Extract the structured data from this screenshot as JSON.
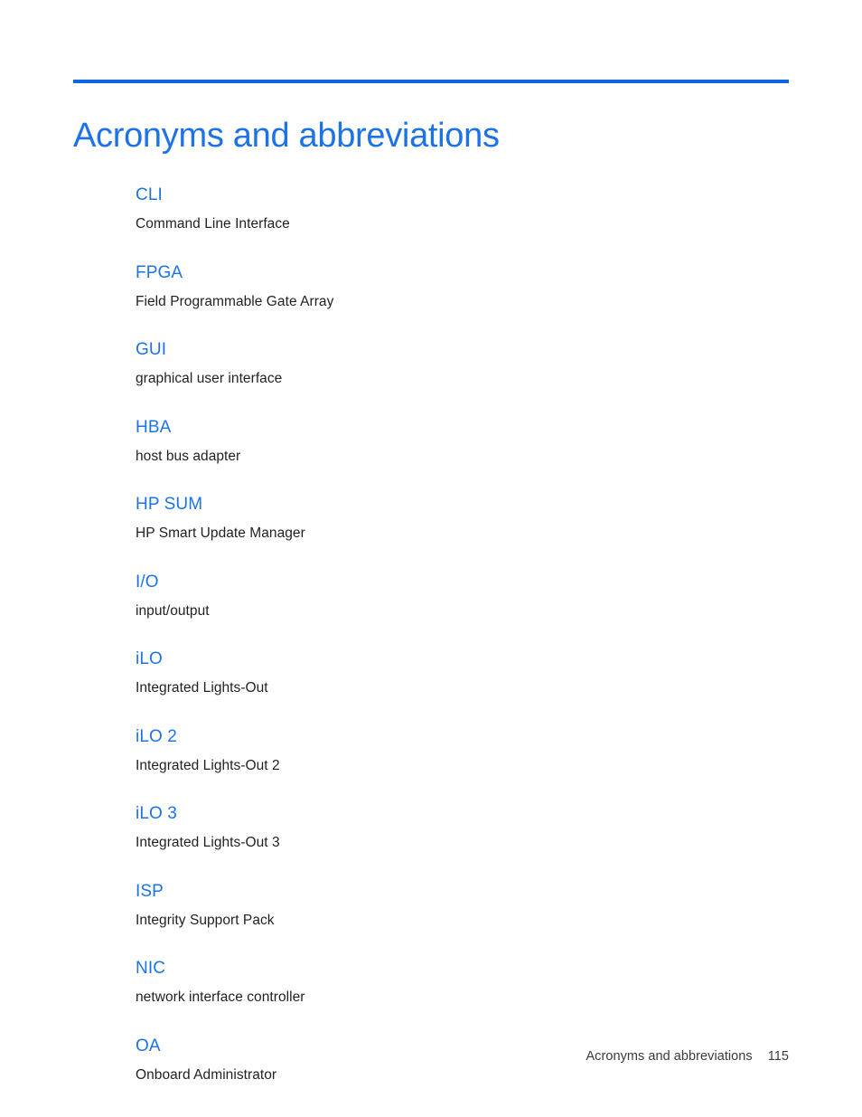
{
  "document": {
    "heading": "Acronyms and abbreviations",
    "accent_rule_color": "#0B66E4",
    "heading_color": "#1C73E8",
    "body_text_color": "#231F20"
  },
  "glossary": {
    "entries": [
      {
        "term": "CLI",
        "definition": "Command Line Interface"
      },
      {
        "term": "FPGA",
        "definition": "Field Programmable Gate Array"
      },
      {
        "term": "GUI",
        "definition": "graphical user interface"
      },
      {
        "term": "HBA",
        "definition": "host bus adapter"
      },
      {
        "term": "HP SUM",
        "definition": "HP Smart Update Manager"
      },
      {
        "term": "I/O",
        "definition": "input/output"
      },
      {
        "term": "iLO",
        "definition": "Integrated Lights-Out"
      },
      {
        "term": "iLO 2",
        "definition": "Integrated Lights-Out 2"
      },
      {
        "term": "iLO 3",
        "definition": "Integrated Lights-Out 3"
      },
      {
        "term": "ISP",
        "definition": "Integrity Support Pack"
      },
      {
        "term": "NIC",
        "definition": "network interface controller"
      },
      {
        "term": "OA",
        "definition": "Onboard Administrator"
      }
    ]
  },
  "footer": {
    "section": "Acronyms and abbreviations",
    "page_number": "115"
  }
}
